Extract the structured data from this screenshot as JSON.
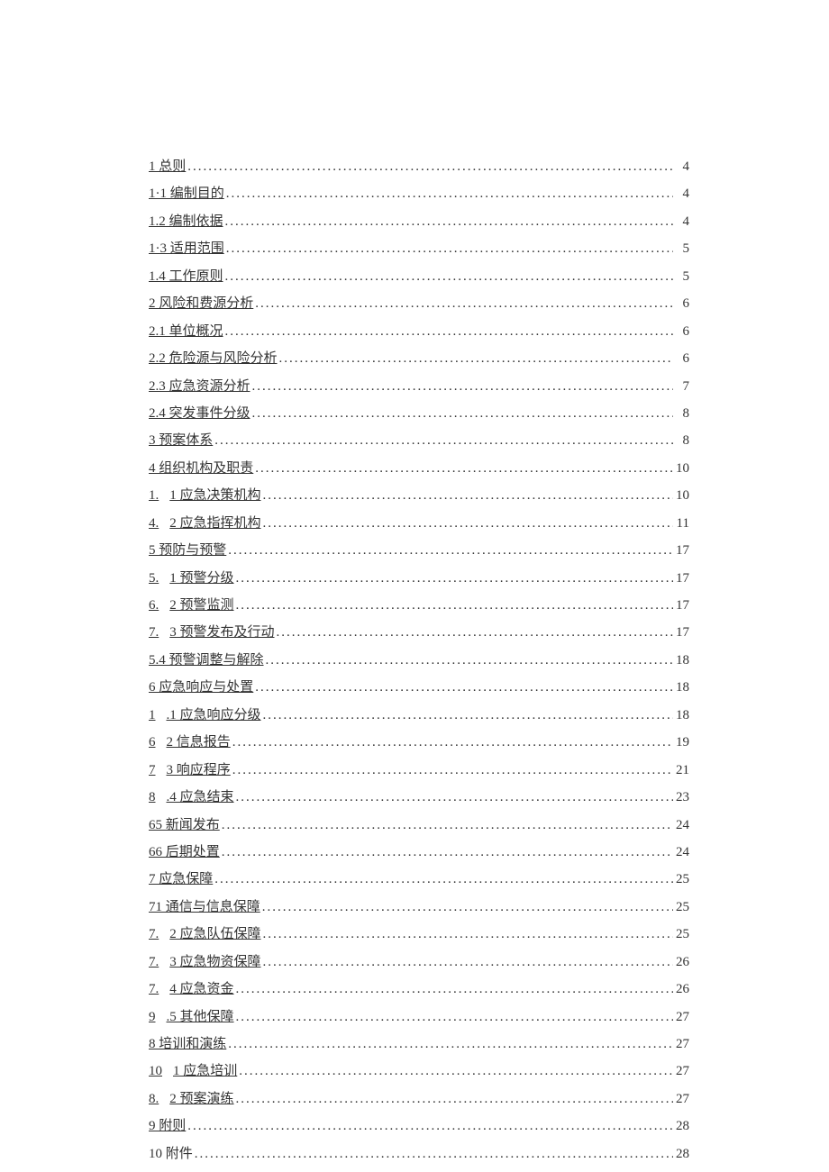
{
  "toc": [
    {
      "prefix": "1 总则",
      "prefixSpaced": false,
      "text": "",
      "underline": true,
      "page": "4"
    },
    {
      "prefix": "1·1 编制目的",
      "prefixSpaced": false,
      "text": "",
      "underline": true,
      "page": "4"
    },
    {
      "prefix": "1.2 编制依据",
      "prefixSpaced": false,
      "text": "",
      "underline": true,
      "page": "4"
    },
    {
      "prefix": "1·3 适用范围",
      "prefixSpaced": false,
      "text": "",
      "underline": true,
      "page": "5"
    },
    {
      "prefix": "1.4 工作原则",
      "prefixSpaced": false,
      "text": "",
      "underline": true,
      "page": "5"
    },
    {
      "prefix": "2 风险和费源分析",
      "prefixSpaced": false,
      "text": "",
      "underline": true,
      "page": "6"
    },
    {
      "prefix": "2.1 单位概况",
      "prefixSpaced": false,
      "text": "",
      "underline": true,
      "page": "6"
    },
    {
      "prefix": "2.2 危险源与风险分析",
      "prefixSpaced": false,
      "text": "",
      "underline": true,
      "page": "6"
    },
    {
      "prefix": "2.3 应急资源分析",
      "prefixSpaced": false,
      "text": "",
      "underline": true,
      "page": "7"
    },
    {
      "prefix": "2.4 突发事件分级",
      "prefixSpaced": false,
      "text": "",
      "underline": true,
      "page": "8"
    },
    {
      "prefix": "3 预案体系",
      "prefixSpaced": false,
      "text": "",
      "underline": true,
      "page": "8"
    },
    {
      "prefix": "4 组织机构及职责",
      "prefixSpaced": false,
      "text": "",
      "underline": true,
      "page": "10"
    },
    {
      "prefix": "1.",
      "prefixSpaced": true,
      "text": "1 应急决策机构",
      "underline": true,
      "page": "10"
    },
    {
      "prefix": "4.",
      "prefixSpaced": true,
      "text": "2 应急指挥机构",
      "underline": true,
      "page": "11"
    },
    {
      "prefix": "5 预防与预警",
      "prefixSpaced": false,
      "text": "",
      "underline": true,
      "page": "17"
    },
    {
      "prefix": "5.",
      "prefixSpaced": true,
      "text": "1 预警分级",
      "underline": true,
      "page": "17"
    },
    {
      "prefix": "6.",
      "prefixSpaced": true,
      "text": "2 预警监测",
      "underline": true,
      "page": "17"
    },
    {
      "prefix": "7.",
      "prefixSpaced": true,
      "text": "3 预警发布及行动",
      "underline": true,
      "page": "17"
    },
    {
      "prefix": "5.4 预警调整与解除",
      "prefixSpaced": false,
      "text": "",
      "underline": true,
      "page": "18"
    },
    {
      "prefix": "6 应急响应与处置",
      "prefixSpaced": false,
      "text": "",
      "underline": true,
      "page": "18"
    },
    {
      "prefix": "1",
      "prefixSpaced": true,
      "text": ".1 应急响应分级",
      "underline": true,
      "page": "18"
    },
    {
      "prefix": "6",
      "prefixSpaced": true,
      "text": "2 信息报告",
      "underline": true,
      "page": "19"
    },
    {
      "prefix": "7",
      "prefixSpaced": true,
      "text": "3 响应程序",
      "underline": true,
      "page": "21"
    },
    {
      "prefix": "8",
      "prefixSpaced": true,
      "text": ".4 应急结束",
      "underline": true,
      "page": "23"
    },
    {
      "prefix": "65 新闻发布",
      "prefixSpaced": false,
      "text": "",
      "underline": true,
      "page": "24"
    },
    {
      "prefix": "66 后期处置",
      "prefixSpaced": false,
      "text": "",
      "underline": true,
      "page": "24"
    },
    {
      "prefix": "7 应急保障",
      "prefixSpaced": false,
      "text": "",
      "underline": true,
      "page": "25"
    },
    {
      "prefix": "71 通信与信息保障",
      "prefixSpaced": false,
      "text": "",
      "underline": true,
      "page": "25"
    },
    {
      "prefix": "7.",
      "prefixSpaced": true,
      "text": "2 应急队伍保障",
      "underline": true,
      "page": "25"
    },
    {
      "prefix": "7.",
      "prefixSpaced": true,
      "text": "3 应急物资保障",
      "underline": true,
      "page": "26"
    },
    {
      "prefix": "7.",
      "prefixSpaced": true,
      "text": "4 应急资金",
      "underline": true,
      "page": "26"
    },
    {
      "prefix": "9",
      "prefixSpaced": true,
      "text": ".5 其他保障",
      "underline": true,
      "page": "27"
    },
    {
      "prefix": "8 培训和演练",
      "prefixSpaced": false,
      "text": "",
      "underline": true,
      "page": "27"
    },
    {
      "prefix": "10",
      "prefixSpaced": true,
      "text": "1 应急培训",
      "underline": true,
      "page": "27"
    },
    {
      "prefix": "8.",
      "prefixSpaced": true,
      "text": "2 预案演练",
      "underline": true,
      "page": "27"
    },
    {
      "prefix": "9 附则",
      "prefixSpaced": false,
      "text": "",
      "underline": true,
      "page": "28"
    },
    {
      "prefix": "10 附件",
      "prefixSpaced": false,
      "text": "",
      "underline": false,
      "page": "28"
    }
  ]
}
